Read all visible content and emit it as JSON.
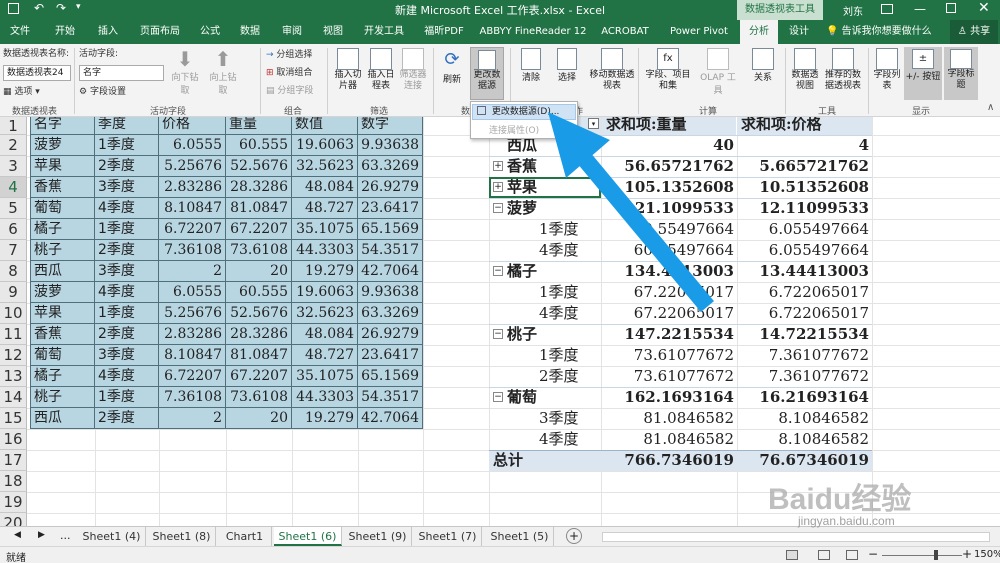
{
  "title_bar": {
    "filename": "新建 Microsoft Excel 工作表.xlsx - Excel",
    "context_tab": "数据透视表工具",
    "user": "刘东"
  },
  "tabs": [
    "文件",
    "开始",
    "插入",
    "页面布局",
    "公式",
    "数据",
    "审阅",
    "视图",
    "开发工具",
    "福昕PDF",
    "ABBYY FineReader 12",
    "ACROBAT",
    "Power Pivot",
    "分析",
    "设计"
  ],
  "tell_me": "告诉我你想要做什么",
  "share": "共享",
  "ribbon": {
    "pivot_name_label": "数据透视表名称:",
    "pivot_name_value": "数据透视表24",
    "options_button": "选项",
    "active_field_label": "活动字段:",
    "active_field_value": "名字",
    "field_settings": "字段设置",
    "drill_down": "向下钻取",
    "drill_up": "向上钻取",
    "group_selection": "分组选择",
    "ungroup": "取消组合",
    "group_field": "分组字段",
    "insert_slicer": "插入切片器",
    "insert_timeline": "插入日程表",
    "filter_connections": "筛选器连接",
    "refresh": "刷新",
    "change_source": "更改数据源",
    "clear": "清除",
    "select": "选择",
    "move_pivot": "移动数据透视表",
    "fields_items": "字段、项目和集",
    "olap_tools": "OLAP 工具",
    "relationships": "关系",
    "pivot_chart": "数据透视图",
    "recommended": "推荐的数据透视表",
    "field_list": "字段列表",
    "buttons_toggle": "+/- 按钮",
    "field_headers": "字段标题",
    "groups": {
      "pivot_table": "数据透视表",
      "active_field": "活动字段",
      "group": "组合",
      "filter": "筛选",
      "data": "数",
      "actions": "操作",
      "calculations": "计算",
      "tools": "工具",
      "show": "显示"
    }
  },
  "dropdown": {
    "items": [
      "更改数据源(D)...",
      "连接属性(O)"
    ]
  },
  "row_numbers": [
    "1",
    "2",
    "3",
    "4",
    "5",
    "6",
    "7",
    "8",
    "9",
    "10",
    "11",
    "12",
    "13",
    "14",
    "15",
    "16",
    "17",
    "18",
    "19",
    "20"
  ],
  "source_table": {
    "headers": [
      "名字",
      "季度",
      "价格",
      "重量",
      "数值",
      "数字"
    ],
    "rows": [
      [
        "菠萝",
        "1季度",
        "6.0555",
        "60.555",
        "19.6063",
        "9.93638"
      ],
      [
        "苹果",
        "2季度",
        "5.25676",
        "52.5676",
        "32.5623",
        "63.3269"
      ],
      [
        "香蕉",
        "3季度",
        "2.83286",
        "28.3286",
        "48.084",
        "26.9279"
      ],
      [
        "葡萄",
        "4季度",
        "8.10847",
        "81.0847",
        "48.727",
        "23.6417"
      ],
      [
        "橘子",
        "1季度",
        "6.72207",
        "67.2207",
        "35.1075",
        "65.1569"
      ],
      [
        "桃子",
        "2季度",
        "7.36108",
        "73.6108",
        "44.3303",
        "54.3517"
      ],
      [
        "西瓜",
        "3季度",
        "2",
        "20",
        "19.279",
        "42.7064"
      ],
      [
        "菠萝",
        "4季度",
        "6.0555",
        "60.555",
        "19.6063",
        "9.93638"
      ],
      [
        "苹果",
        "1季度",
        "5.25676",
        "52.5676",
        "32.5623",
        "63.3269"
      ],
      [
        "香蕉",
        "2季度",
        "2.83286",
        "28.3286",
        "48.084",
        "26.9279"
      ],
      [
        "葡萄",
        "3季度",
        "8.10847",
        "81.0847",
        "48.727",
        "23.6417"
      ],
      [
        "橘子",
        "4季度",
        "6.72207",
        "67.2207",
        "35.1075",
        "65.1569"
      ],
      [
        "桃子",
        "1季度",
        "7.36108",
        "73.6108",
        "44.3303",
        "54.3517"
      ],
      [
        "西瓜",
        "2季度",
        "2",
        "20",
        "19.279",
        "42.7064"
      ]
    ]
  },
  "pivot": {
    "header": [
      "求和项:重量",
      "求和项:价格"
    ],
    "rows": [
      {
        "label": "西瓜",
        "v1": "40",
        "v2": "4",
        "type": "group"
      },
      {
        "label": "香蕉",
        "v1": "56.65721762",
        "v2": "5.665721762",
        "type": "group",
        "expand": "+"
      },
      {
        "label": "苹果",
        "v1": "105.1352608",
        "v2": "10.51352608",
        "type": "group",
        "expand": "+"
      },
      {
        "label": "菠萝",
        "v1": "121.1099533",
        "v2": "12.11099533",
        "type": "group",
        "expand": "−"
      },
      {
        "label": "1季度",
        "v1": "60.55497664",
        "v2": "6.055497664",
        "type": "sub"
      },
      {
        "label": "4季度",
        "v1": "60.55497664",
        "v2": "6.055497664",
        "type": "sub"
      },
      {
        "label": "橘子",
        "v1": "134.4413003",
        "v2": "13.44413003",
        "type": "group",
        "expand": "−"
      },
      {
        "label": "1季度",
        "v1": "67.22065017",
        "v2": "6.722065017",
        "type": "sub"
      },
      {
        "label": "4季度",
        "v1": "67.22065017",
        "v2": "6.722065017",
        "type": "sub"
      },
      {
        "label": "桃子",
        "v1": "147.2215534",
        "v2": "14.72215534",
        "type": "group",
        "expand": "−"
      },
      {
        "label": "1季度",
        "v1": "73.61077672",
        "v2": "7.361077672",
        "type": "sub"
      },
      {
        "label": "2季度",
        "v1": "73.61077672",
        "v2": "7.361077672",
        "type": "sub"
      },
      {
        "label": "葡萄",
        "v1": "162.1693164",
        "v2": "16.21693164",
        "type": "group",
        "expand": "−"
      },
      {
        "label": "3季度",
        "v1": "81.0846582",
        "v2": "8.10846582",
        "type": "sub"
      },
      {
        "label": "4季度",
        "v1": "81.0846582",
        "v2": "8.10846582",
        "type": "sub"
      },
      {
        "label": "总计",
        "v1": "766.7346019",
        "v2": "76.67346019",
        "type": "total"
      }
    ]
  },
  "sheet_tabs": [
    "Sheet1 (4)",
    "Sheet1 (8)",
    "Chart1",
    "Sheet1 (6)",
    "Sheet1 (9)",
    "Sheet1 (7)",
    "Sheet1 (5)"
  ],
  "sheet_nav_more": "...",
  "status": {
    "ready": "就绪",
    "zoom": "150%"
  },
  "watermark": {
    "brand": "Baidu经验",
    "url": "jingyan.baidu.com"
  },
  "colors": {
    "excel_green": "#217346",
    "table_fill": "#b8d6e2",
    "arrow": "#1a9be8"
  }
}
